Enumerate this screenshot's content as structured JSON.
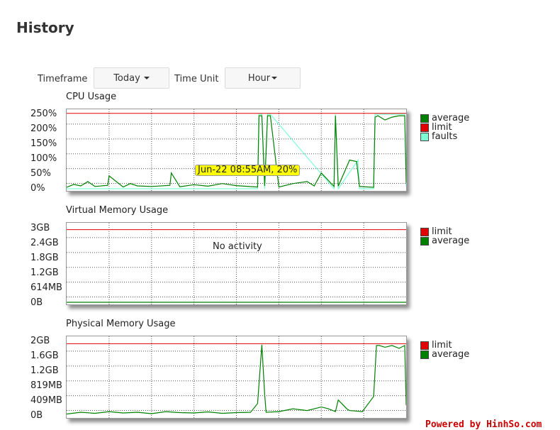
{
  "page": {
    "title": "History"
  },
  "controls": {
    "timeframe_label": "Timeframe",
    "timeframe_value": "Today",
    "time_unit_label": "Time Unit",
    "time_unit_value": "Hour"
  },
  "colors": {
    "average": "#008000",
    "limit": "#e00000",
    "faults": "#7fffd4",
    "grid": "#555555",
    "tooltip_bg": "#ffff00",
    "credit": "#cc0000"
  },
  "chart_data": [
    {
      "type": "line",
      "title": "CPU Usage",
      "y_ticks": [
        "250%",
        "200%",
        "150%",
        "100%",
        "50%",
        "0%"
      ],
      "ylim": [
        0,
        270
      ],
      "xlim": [
        0,
        24
      ],
      "legend_position": "right",
      "grid": true,
      "legend": [
        {
          "name": "average",
          "color": "#008000"
        },
        {
          "name": "limit",
          "color": "#e00000"
        },
        {
          "name": "faults",
          "color": "#7fffd4"
        }
      ],
      "tooltip": "Jun-22 08:55AM, 20%",
      "series": [
        {
          "name": "limit",
          "x": [
            0,
            24
          ],
          "y": [
            263,
            263
          ]
        },
        {
          "name": "average",
          "x": [
            0,
            0.5,
            1,
            1.5,
            2,
            2.9,
            3,
            4,
            4.5,
            5,
            6,
            7.3,
            7.4,
            8,
            9,
            10,
            11,
            12,
            13.5,
            13.6,
            13.8,
            14,
            14.2,
            14.4,
            15,
            16,
            17,
            17.5,
            18,
            18.9,
            19,
            19.2,
            20,
            20.5,
            20.7,
            21.7,
            21.8,
            22,
            22.5,
            23,
            23.5,
            23.9,
            24
          ],
          "y": [
            5,
            15,
            10,
            25,
            8,
            12,
            45,
            6,
            18,
            10,
            8,
            12,
            55,
            7,
            14,
            9,
            18,
            11,
            6,
            255,
            255,
            10,
            255,
            255,
            6,
            18,
            25,
            10,
            55,
            8,
            255,
            9,
            100,
            95,
            8,
            5,
            250,
            255,
            240,
            250,
            255,
            255,
            20
          ]
        },
        {
          "name": "faults",
          "x": [
            0,
            13.5,
            13.6,
            13.8,
            14,
            14.2,
            14.4,
            18.9,
            19,
            19.2,
            20.6,
            20.7,
            21.7,
            21.8,
            23.9,
            24
          ],
          "y": [
            0,
            0,
            260,
            260,
            0,
            260,
            260,
            0,
            260,
            0,
            100,
            0,
            0,
            260,
            260,
            10
          ]
        }
      ]
    },
    {
      "type": "line",
      "title": "Virtual Memory Usage",
      "y_ticks": [
        "3GB",
        "2.4GB",
        "1.8GB",
        "1.2GB",
        "614MB",
        "0B"
      ],
      "ylim": [
        0,
        3.3
      ],
      "xlim": [
        0,
        24
      ],
      "legend_position": "right",
      "grid": true,
      "legend": [
        {
          "name": "limit",
          "color": "#e00000"
        },
        {
          "name": "average",
          "color": "#008000"
        }
      ],
      "annotation": "No activity",
      "series": [
        {
          "name": "limit",
          "x": [
            0,
            24
          ],
          "y": [
            3.1,
            3.1
          ]
        },
        {
          "name": "average",
          "x": [
            0,
            24
          ],
          "y": [
            0,
            0
          ]
        }
      ]
    },
    {
      "type": "line",
      "title": "Physical Memory Usage",
      "y_ticks": [
        "2GB",
        "1.6GB",
        "1.2GB",
        "819MB",
        "409MB",
        "0B"
      ],
      "ylim": [
        0,
        2.2
      ],
      "xlim": [
        0,
        24
      ],
      "legend_position": "right",
      "grid": true,
      "legend": [
        {
          "name": "limit",
          "color": "#e00000"
        },
        {
          "name": "average",
          "color": "#008000"
        }
      ],
      "series": [
        {
          "name": "limit",
          "x": [
            0,
            24
          ],
          "y": [
            2.05,
            2.05
          ]
        },
        {
          "name": "average",
          "x": [
            0,
            1,
            2,
            3,
            4,
            5,
            6,
            7,
            8,
            9,
            10,
            11,
            12,
            13,
            13.5,
            13.8,
            14,
            14.1,
            15,
            16,
            17,
            18,
            18.5,
            19,
            19.2,
            19.8,
            20,
            20.9,
            21.7,
            21.9,
            22.1,
            22.5,
            23,
            23.5,
            23.9,
            24
          ],
          "y": [
            0.05,
            0.1,
            0.07,
            0.12,
            0.08,
            0.1,
            0.06,
            0.12,
            0.09,
            0.08,
            0.11,
            0.07,
            0.09,
            0.1,
            0.35,
            2.02,
            0.6,
            0.1,
            0.12,
            0.2,
            0.15,
            0.25,
            0.2,
            0.12,
            0.45,
            0.2,
            0.15,
            0.12,
            0.55,
            2.0,
            2.0,
            1.95,
            2.0,
            1.92,
            2.0,
            0.3
          ]
        }
      ]
    }
  ],
  "footer": {
    "credit": "Powered by HinhSo.com"
  }
}
